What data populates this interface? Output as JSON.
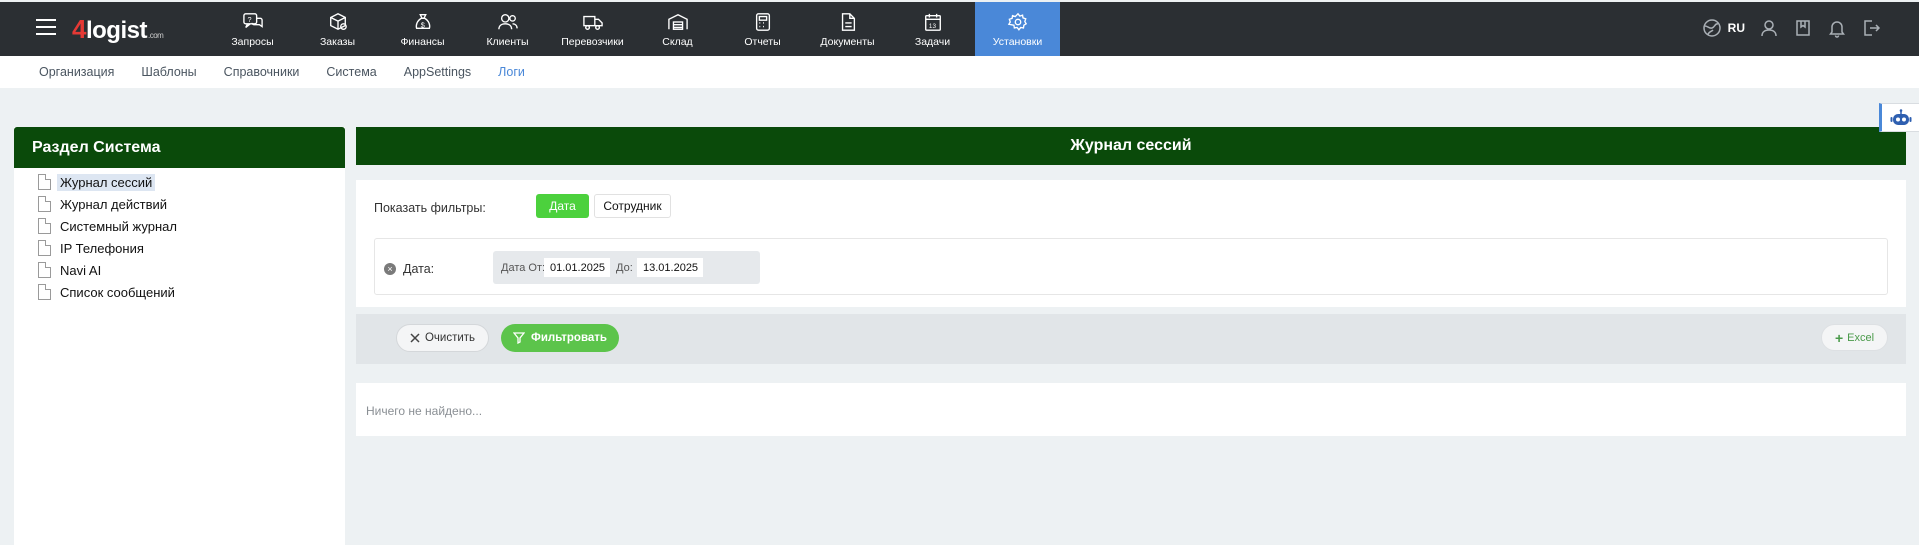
{
  "app": {
    "logo_four": "4",
    "logo_name": "logist",
    "logo_suffix": ".com"
  },
  "nav": {
    "items": [
      {
        "label": "Запросы",
        "icon": "chat-question-icon"
      },
      {
        "label": "Заказы",
        "icon": "package-icon"
      },
      {
        "label": "Финансы",
        "icon": "money-bag-icon"
      },
      {
        "label": "Клиенты",
        "icon": "users-icon"
      },
      {
        "label": "Перевозчики",
        "icon": "truck-icon"
      },
      {
        "label": "Склад",
        "icon": "warehouse-icon"
      },
      {
        "label": "Отчеты",
        "icon": "calculator-icon"
      },
      {
        "label": "Документы",
        "icon": "document-icon"
      },
      {
        "label": "Задачи",
        "icon": "calendar-icon"
      },
      {
        "label": "Установки",
        "icon": "gear-icon"
      }
    ],
    "active": "Установки",
    "lang": "RU"
  },
  "subnav": {
    "items": [
      "Организация",
      "Шаблоны",
      "Справочники",
      "Система",
      "AppSettings",
      "Логи"
    ],
    "active": "Логи"
  },
  "sidebar": {
    "title": "Раздел Система",
    "items": [
      {
        "label": "Журнал сессий"
      },
      {
        "label": "Журнал действий"
      },
      {
        "label": "Системный журнал"
      },
      {
        "label": "IP Телефония"
      },
      {
        "label": "Navi AI"
      },
      {
        "label": "Список сообщений"
      }
    ],
    "selected": "Журнал сессий"
  },
  "main": {
    "title": "Журнал сессий",
    "filters": {
      "label": "Показать фильтры:",
      "chip_date": "Дата",
      "chip_employee": "Сотрудник",
      "date_label": "Дата:",
      "from_label": "Дата От:",
      "from_value": "01.01.2025",
      "to_label": "До:",
      "to_value": "13.01.2025"
    },
    "actions": {
      "clear": "Очистить",
      "filter": "Фильтровать",
      "excel": "Excel"
    },
    "empty_message": "Ничего не найдено..."
  },
  "colors": {
    "topbar": "#2b2f33",
    "active_nav": "#4a88d8",
    "header_green": "#0a4a0a",
    "chip_green": "#4cd13d",
    "filter_btn": "#5cc44b"
  }
}
